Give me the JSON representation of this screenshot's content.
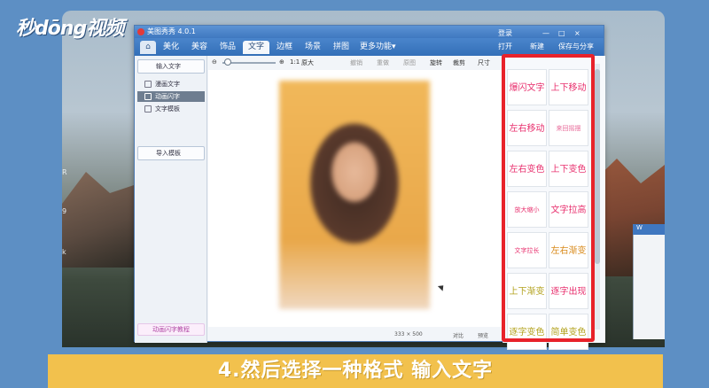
{
  "logo": {
    "text": "秒dōng视频"
  },
  "app": {
    "title": "美图秀秀 4.0.1",
    "window_controls": [
      "登录",
      "—",
      "□",
      "×"
    ],
    "tabs": [
      {
        "label": "⌂"
      },
      {
        "label": "美化"
      },
      {
        "label": "美容"
      },
      {
        "label": "饰品"
      },
      {
        "label": "文字"
      },
      {
        "label": "边框"
      },
      {
        "label": "场景"
      },
      {
        "label": "拼图"
      },
      {
        "label": "更多功能▾"
      }
    ],
    "active_tab": "文字",
    "top_actions": {
      "open": "打开",
      "new": "新建",
      "save": "保存与分享"
    },
    "left_panel": {
      "input_text": "输入文字",
      "items": [
        {
          "label": "漫画文字"
        },
        {
          "label": "动画闪字"
        },
        {
          "label": "文字模板"
        }
      ],
      "import_template": "导入模板",
      "promo": "动画闪字教程"
    },
    "toolbar": {
      "zoom_ratio": "1:1",
      "zoom_label": "原大",
      "undo": "撤销",
      "redo": "重做",
      "original": "原图",
      "rotate": "旋转",
      "crop": "裁剪",
      "size": "尺寸"
    },
    "status": {
      "dimensions": "333 × 500",
      "compare": "对比",
      "preview": "预览"
    },
    "effects": [
      {
        "label": "爆闪文字",
        "color": "#e8306e"
      },
      {
        "label": "上下移动",
        "color": "#e8306e"
      },
      {
        "label": "左右移动",
        "color": "#e8306e"
      },
      {
        "label": "来回摇摆",
        "color": "#e86b9a",
        "small": true
      },
      {
        "label": "左右变色",
        "color": "#e8306e"
      },
      {
        "label": "上下变色",
        "color": "#e8306e"
      },
      {
        "label": "放大缩小",
        "color": "#e8306e",
        "small": true
      },
      {
        "label": "文字拉高",
        "color": "#e8306e"
      },
      {
        "label": "文字拉长",
        "color": "#e8306e",
        "small": true
      },
      {
        "label": "左右渐变",
        "color": "#d98a1a"
      },
      {
        "label": "上下渐变",
        "color": "#b3a21e"
      },
      {
        "label": "逐字出现",
        "color": "#e8306e"
      },
      {
        "label": "逐字变色",
        "color": "#b3a21e"
      },
      {
        "label": "简单变色",
        "color": "#b3a21e"
      }
    ],
    "highlight_color": "#e8222a"
  },
  "desktop": {
    "side_labels": [
      "R",
      "9",
      "k"
    ]
  },
  "background_window": {
    "title": "W"
  },
  "caption": "4.然后选择一种格式 输入文字"
}
